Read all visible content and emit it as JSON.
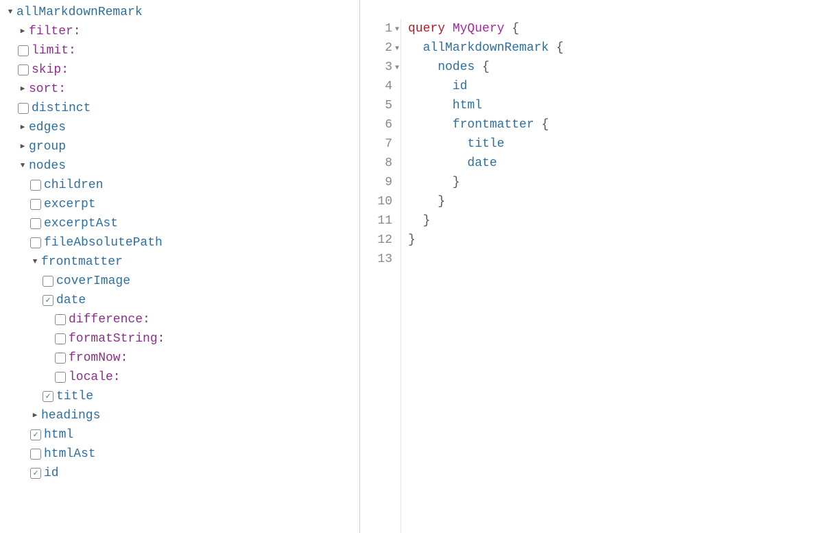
{
  "explorer": {
    "root": "allMarkdownRemark",
    "filter": "filter:",
    "limit": "limit:",
    "skip": "skip:",
    "sort": "sort:",
    "distinct": "distinct",
    "edges": "edges",
    "group": "group",
    "nodes": "nodes",
    "children": "children",
    "excerpt": "excerpt",
    "excerptAst": "excerptAst",
    "fileAbsolutePath": "fileAbsolutePath",
    "frontmatter": "frontmatter",
    "coverImage": "coverImage",
    "date": "date",
    "difference": "difference:",
    "formatString": "formatString:",
    "fromNow": "fromNow:",
    "locale": "locale:",
    "title": "title",
    "headings": "headings",
    "html": "html",
    "htmlAst": "htmlAst",
    "id": "id"
  },
  "code": {
    "lines": [
      {
        "n": 1,
        "fold": true,
        "tokens": [
          {
            "t": "query ",
            "c": "kw"
          },
          {
            "t": "MyQuery ",
            "c": "name"
          },
          {
            "t": "{",
            "c": "brace"
          }
        ]
      },
      {
        "n": 2,
        "fold": true,
        "tokens": [
          {
            "t": "  allMarkdownRemark ",
            "c": "field"
          },
          {
            "t": "{",
            "c": "brace"
          }
        ]
      },
      {
        "n": 3,
        "fold": true,
        "tokens": [
          {
            "t": "    nodes ",
            "c": "field"
          },
          {
            "t": "{",
            "c": "brace"
          }
        ]
      },
      {
        "n": 4,
        "fold": false,
        "tokens": [
          {
            "t": "      id",
            "c": "field"
          }
        ]
      },
      {
        "n": 5,
        "fold": false,
        "tokens": [
          {
            "t": "      html",
            "c": "field"
          }
        ]
      },
      {
        "n": 6,
        "fold": false,
        "tokens": [
          {
            "t": "      frontmatter ",
            "c": "field"
          },
          {
            "t": "{",
            "c": "brace"
          }
        ]
      },
      {
        "n": 7,
        "fold": false,
        "tokens": [
          {
            "t": "        title",
            "c": "field"
          }
        ]
      },
      {
        "n": 8,
        "fold": false,
        "tokens": [
          {
            "t": "        date",
            "c": "field"
          }
        ]
      },
      {
        "n": 9,
        "fold": false,
        "tokens": [
          {
            "t": "      }",
            "c": "brace"
          }
        ]
      },
      {
        "n": 10,
        "fold": false,
        "tokens": [
          {
            "t": "    }",
            "c": "brace"
          }
        ]
      },
      {
        "n": 11,
        "fold": false,
        "tokens": [
          {
            "t": "  }",
            "c": "brace"
          }
        ]
      },
      {
        "n": 12,
        "fold": false,
        "tokens": [
          {
            "t": "}",
            "c": "brace"
          }
        ]
      },
      {
        "n": 13,
        "fold": false,
        "tokens": [
          {
            "t": "",
            "c": ""
          }
        ]
      }
    ]
  }
}
